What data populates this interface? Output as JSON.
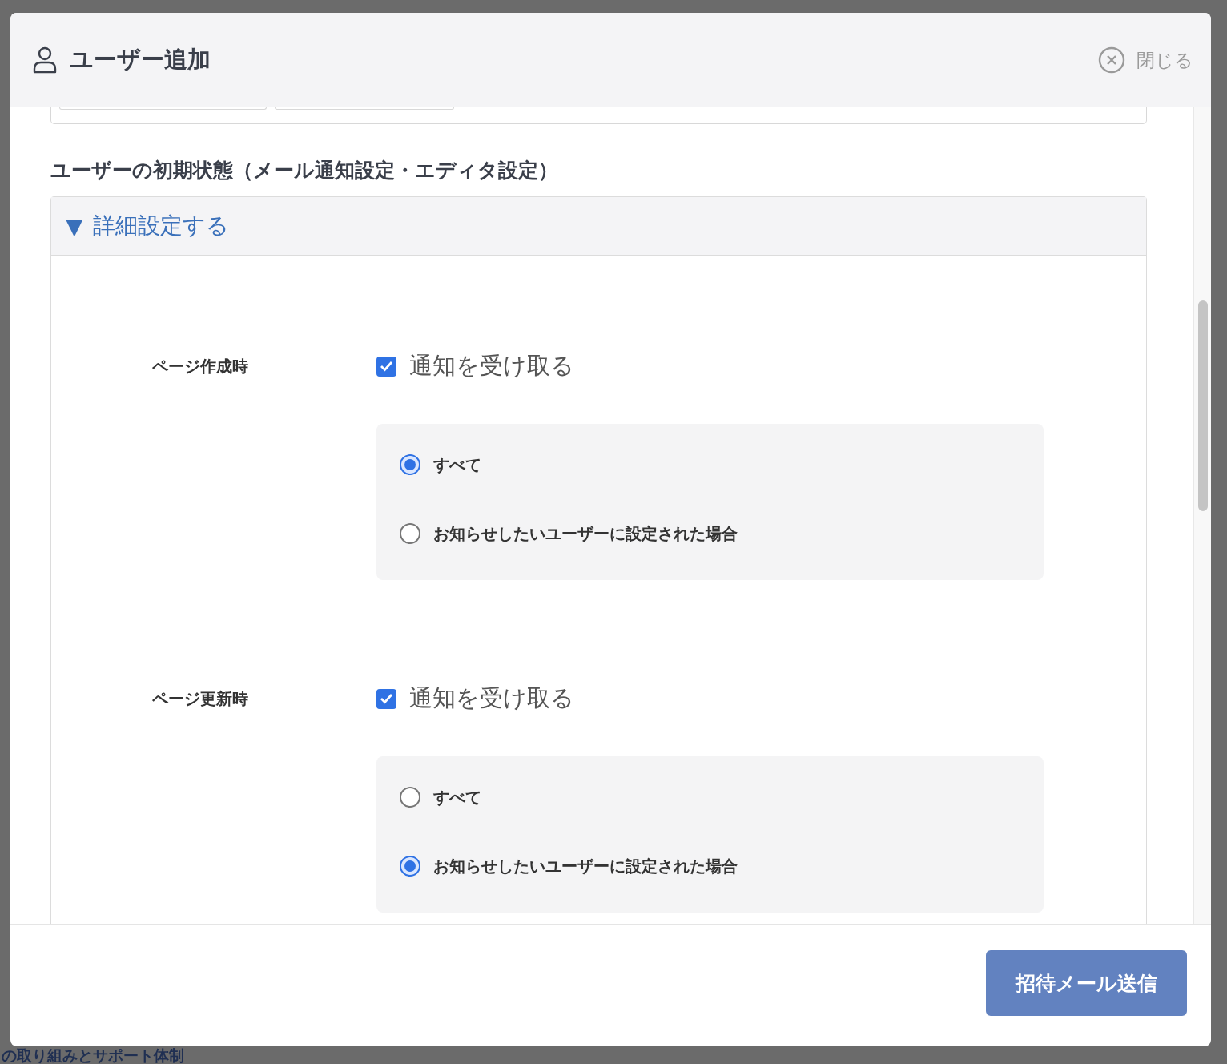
{
  "background": {
    "link": "の取り組みとサポート体制"
  },
  "dialog": {
    "title": "ユーザー追加",
    "close_label": "閉じる"
  },
  "section_heading": "ユーザーの初期状態（メール通知設定・エディタ設定）",
  "details": {
    "marker": "▼",
    "summary": "詳細設定する",
    "expanded": true
  },
  "settings": [
    {
      "label": "ページ作成時",
      "checkbox": {
        "label": "通知を受け取る",
        "checked": true
      },
      "options": [
        {
          "label": "すべて",
          "selected": true
        },
        {
          "label": "お知らせしたいユーザーに設定された場合",
          "selected": false
        }
      ]
    },
    {
      "label": "ページ更新時",
      "checkbox": {
        "label": "通知を受け取る",
        "checked": true
      },
      "options": [
        {
          "label": "すべて",
          "selected": false
        },
        {
          "label": "お知らせしたいユーザーに設定された場合",
          "selected": true
        }
      ]
    }
  ],
  "submit_button": "招待メール送信"
}
